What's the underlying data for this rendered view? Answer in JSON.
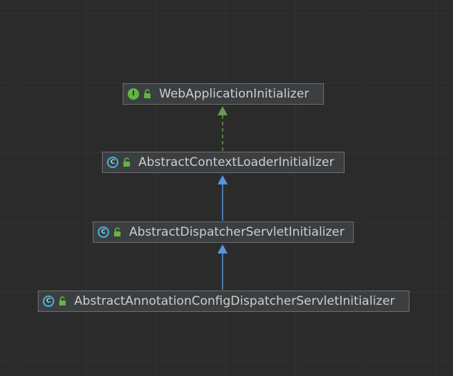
{
  "diagram": {
    "nodes": [
      {
        "id": "web",
        "kind": "I",
        "label": "WebApplicationInitializer"
      },
      {
        "id": "ctx",
        "kind": "C",
        "label": "AbstractContextLoaderInitializer"
      },
      {
        "id": "disp",
        "kind": "C",
        "label": "AbstractDispatcherServletInitializer"
      },
      {
        "id": "anno",
        "kind": "C",
        "label": "AbstractAnnotationConfigDispatcherServletInitializer"
      }
    ],
    "edges": [
      {
        "from": "ctx",
        "to": "web",
        "type": "implements"
      },
      {
        "from": "disp",
        "to": "ctx",
        "type": "extends"
      },
      {
        "from": "anno",
        "to": "disp",
        "type": "extends"
      }
    ],
    "colors": {
      "background": "#2b2b2b",
      "implements_arrow": "#6a9955",
      "extends_arrow": "#5994e0",
      "interface_icon": "#62b543",
      "class_icon": "#40b6e0"
    }
  }
}
